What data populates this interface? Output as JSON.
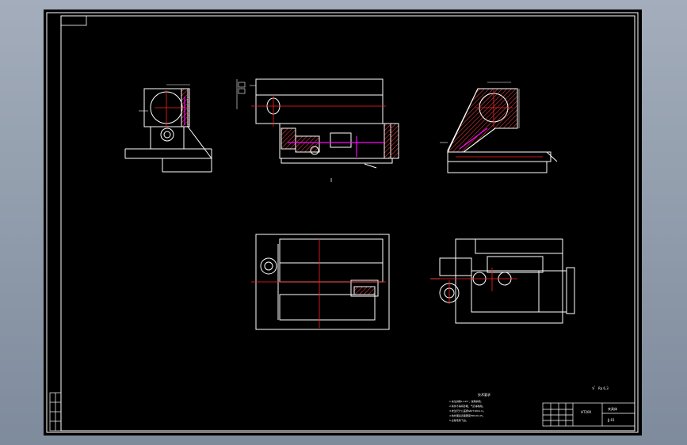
{
  "sheet": {
    "view_label": "I",
    "section_label": "A",
    "notes_title": "技术要求",
    "notes": [
      "1.未注倒角1×45°，锐角倒钝。",
      "2.铸件不得有砂眼、气孔等缺陷。",
      "3.未注尺寸公差按GB/T1804-m。",
      "4.热处理后表面硬度HRC40-45。",
      "5.去除毛刺飞边。"
    ],
    "roughness_label": "√",
    "roughness_value": "Ra 6.3",
    "title_block": {
      "material": "HT200",
      "part_name": "夹具体",
      "drawing_no": "JJ-01"
    },
    "revision_block": [
      "标记",
      "处数",
      "分区",
      "签名",
      "日期"
    ]
  },
  "colors": {
    "frame": "#ffffff",
    "centerline": "#ff2020",
    "hidden": "#ff00ff",
    "hatch": "#ff4444",
    "background": "#000000"
  }
}
